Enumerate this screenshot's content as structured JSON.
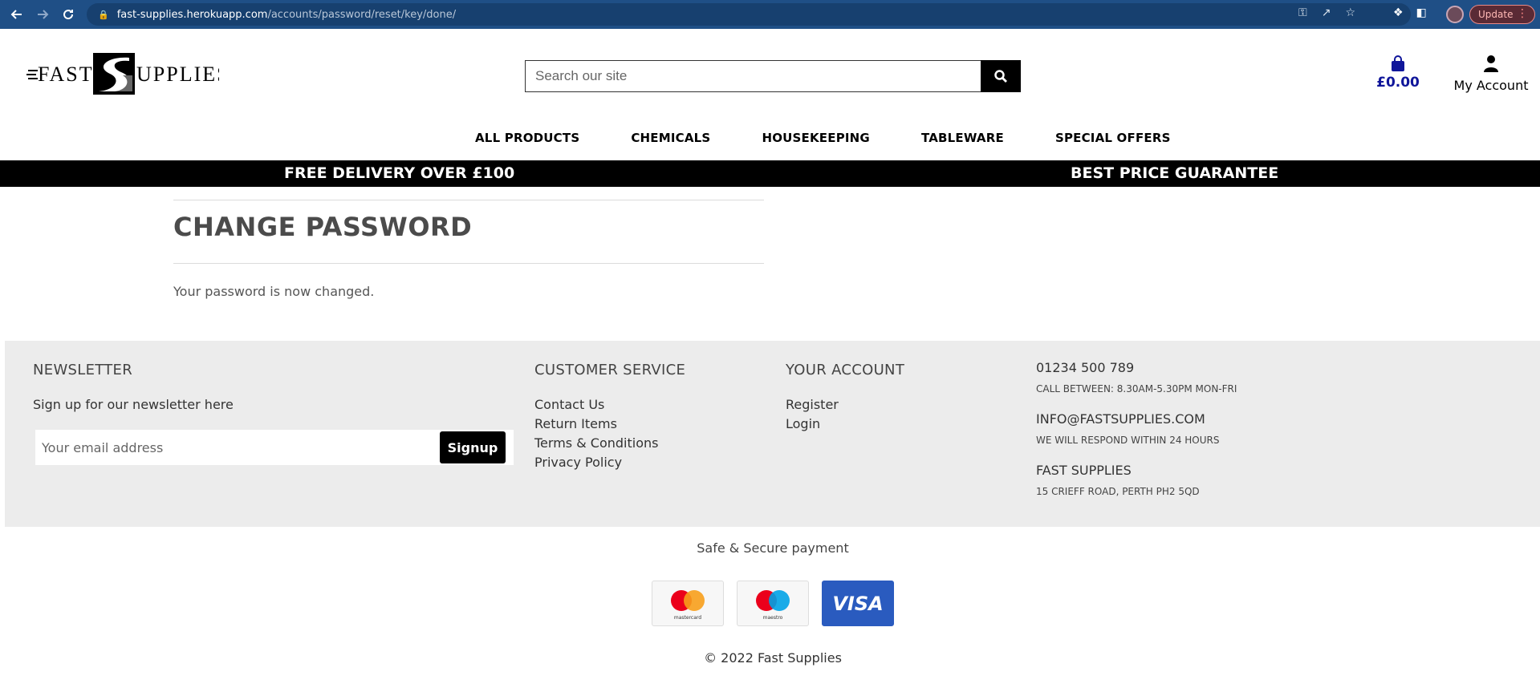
{
  "browser": {
    "url_host": "fast-supplies.herokuapp.com",
    "url_path": "/accounts/password/reset/key/done/",
    "update_label": "Update"
  },
  "header": {
    "logo_text_left": "FAST",
    "logo_text_right": "UPPLIES",
    "search_placeholder": "Search our site",
    "cart_total": "£0.00",
    "account_label": "My Account"
  },
  "nav": {
    "items": [
      "ALL PRODUCTS",
      "CHEMICALS",
      "HOUSEKEEPING",
      "TABLEWARE",
      "SPECIAL OFFERS"
    ]
  },
  "promo": {
    "left": "FREE DELIVERY OVER £100",
    "right": "BEST PRICE GUARANTEE"
  },
  "content": {
    "title": "CHANGE PASSWORD",
    "message": "Your password is now changed."
  },
  "footer": {
    "newsletter": {
      "heading": "NEWSLETTER",
      "text": "Sign up for our newsletter here",
      "email_placeholder": "Your email address",
      "signup_label": "Signup"
    },
    "customer_service": {
      "heading": "CUSTOMER SERVICE",
      "links": [
        "Contact Us",
        "Return Items",
        "Terms & Conditions",
        "Privacy Policy"
      ]
    },
    "your_account": {
      "heading": "YOUR ACCOUNT",
      "links": [
        "Register",
        "Login"
      ]
    },
    "contact": {
      "phone": "01234 500 789",
      "phone_note": "CALL BETWEEN: 8.30AM-5.30PM MON-FRI",
      "email": "INFO@FASTSUPPLIES.COM",
      "email_note": "WE WILL RESPOND WITHIN 24 HOURS",
      "company": "FAST SUPPLIES",
      "address": "15 CRIEFF ROAD, PERTH PH2 5QD"
    }
  },
  "payment": {
    "label": "Safe & Secure payment",
    "cards": [
      "mastercard",
      "maestro",
      "VISA"
    ]
  },
  "copyright": "© 2022 Fast Supplies",
  "colors": {
    "chrome": "#1f4f86",
    "cart_total": "#10169a",
    "footer_bg": "#ececec"
  }
}
